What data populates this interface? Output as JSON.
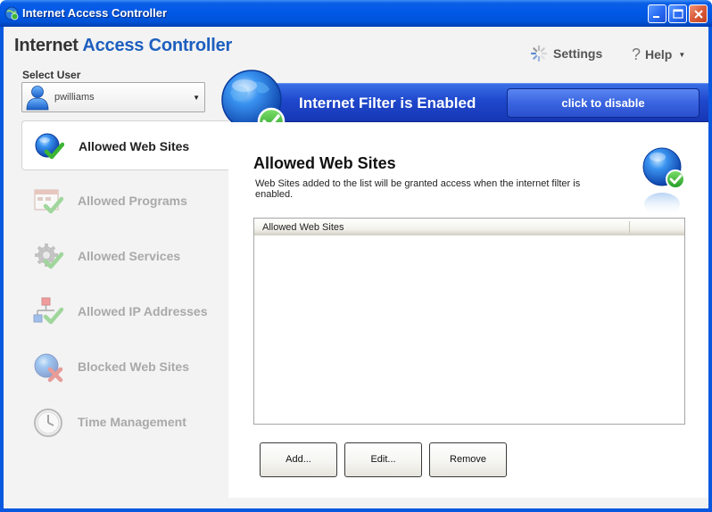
{
  "window": {
    "title": "Internet Access Controller",
    "controls": {
      "minimize": "minimize-icon",
      "maximize": "maximize-icon",
      "close": "close-icon"
    }
  },
  "header": {
    "app_title_part1": "Internet ",
    "app_title_part2": "Access Controller",
    "settings_label": "Settings",
    "help_label": "Help",
    "help_icon": "?"
  },
  "user": {
    "label": "Select User",
    "selected": "pwilliams"
  },
  "banner": {
    "status_text": "Internet Filter is Enabled",
    "toggle_label": "click to disable"
  },
  "sidebar": {
    "items": [
      {
        "label": "Allowed Web Sites",
        "icon": "globe-check-icon",
        "active": true
      },
      {
        "label": "Allowed Programs",
        "icon": "program-window-check-icon",
        "active": false
      },
      {
        "label": "Allowed Services",
        "icon": "gear-check-icon",
        "active": false
      },
      {
        "label": "Allowed IP Addresses",
        "icon": "network-check-icon",
        "active": false
      },
      {
        "label": "Blocked Web Sites",
        "icon": "globe-x-icon",
        "active": false
      },
      {
        "label": "Time Management",
        "icon": "clock-icon",
        "active": false
      }
    ]
  },
  "main": {
    "title": "Allowed Web Sites",
    "description": "Web Sites added to the list will be granted access when the internet filter is enabled.",
    "list": {
      "columns": [
        "Allowed Web Sites"
      ],
      "rows": []
    },
    "buttons": {
      "add": "Add...",
      "edit": "Edit...",
      "remove": "Remove"
    }
  },
  "colors": {
    "titlebar": "#0058e6",
    "accent": "#1d5fbf",
    "banner": "#1f47cc",
    "check_green": "#3cb534",
    "blocked_red": "#d9342b"
  }
}
